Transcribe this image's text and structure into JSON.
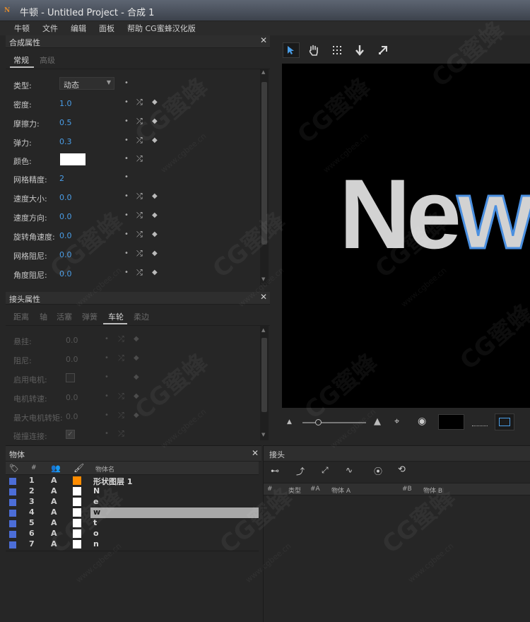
{
  "window": {
    "title": "牛顿 - Untitled Project - 合成 1",
    "logo": "N"
  },
  "menu": [
    "牛顿",
    "文件",
    "编辑",
    "面板",
    "帮助 CG蜜蜂汉化版"
  ],
  "composition_panel": {
    "title": "合成属性",
    "tabs": [
      "常规",
      "高级"
    ],
    "props": [
      {
        "label": "类型:",
        "value": "动态"
      },
      {
        "label": "密度:",
        "value": "1.0"
      },
      {
        "label": "摩擦力:",
        "value": "0.5"
      },
      {
        "label": "弹力:",
        "value": "0.3"
      },
      {
        "label": "颜色:",
        "value": ""
      },
      {
        "label": "网格精度:",
        "value": "2"
      },
      {
        "label": "速度大小:",
        "value": "0.0"
      },
      {
        "label": "速度方向:",
        "value": "0.0"
      },
      {
        "label": "旋转角速度:",
        "value": "0.0"
      },
      {
        "label": "网格阻尼:",
        "value": "0.0"
      },
      {
        "label": "角度阻尼:",
        "value": "0.0"
      }
    ]
  },
  "joint_props_panel": {
    "title": "接头属性",
    "tabs": [
      "距离",
      "轴",
      "活塞",
      "弹簧",
      "车轮",
      "柔边"
    ],
    "props": [
      {
        "label": "悬挂:",
        "value": "0.0"
      },
      {
        "label": "阻尼:",
        "value": "0.0"
      },
      {
        "label": "启用电机:",
        "value": ""
      },
      {
        "label": "电机转速:",
        "value": "0.0"
      },
      {
        "label": "最大电机转矩:",
        "value": "0.0"
      },
      {
        "label": "碰撞连接:",
        "value": ""
      }
    ]
  },
  "objects_panel": {
    "title": "物体",
    "headers": {
      "num": "#",
      "name": "物体名"
    },
    "rows": [
      {
        "num": "1",
        "a": "A",
        "color": "#ff8c00",
        "name": "形状图层 1"
      },
      {
        "num": "2",
        "a": "A",
        "color": "#ffffff",
        "name": "N"
      },
      {
        "num": "3",
        "a": "A",
        "color": "#ffffff",
        "name": "e"
      },
      {
        "num": "4",
        "a": "A",
        "color": "#ffffff",
        "name": "w"
      },
      {
        "num": "5",
        "a": "A",
        "color": "#ffffff",
        "name": "t"
      },
      {
        "num": "6",
        "a": "A",
        "color": "#ffffff",
        "name": "o"
      },
      {
        "num": "7",
        "a": "A",
        "color": "#ffffff",
        "name": "n"
      }
    ]
  },
  "joints_panel": {
    "title": "接头",
    "headers": [
      "#",
      "类型",
      "#A",
      "物体 A",
      "#B",
      "物体 B"
    ]
  },
  "viewer": {
    "text_plain": "Ne",
    "text_outlined": "w"
  },
  "watermark": {
    "logo": "CG蜜蜂",
    "url": "www.cgbee.cn"
  },
  "colors": {
    "accent": "#4a9ee8",
    "selection": "#a8a8a8"
  }
}
